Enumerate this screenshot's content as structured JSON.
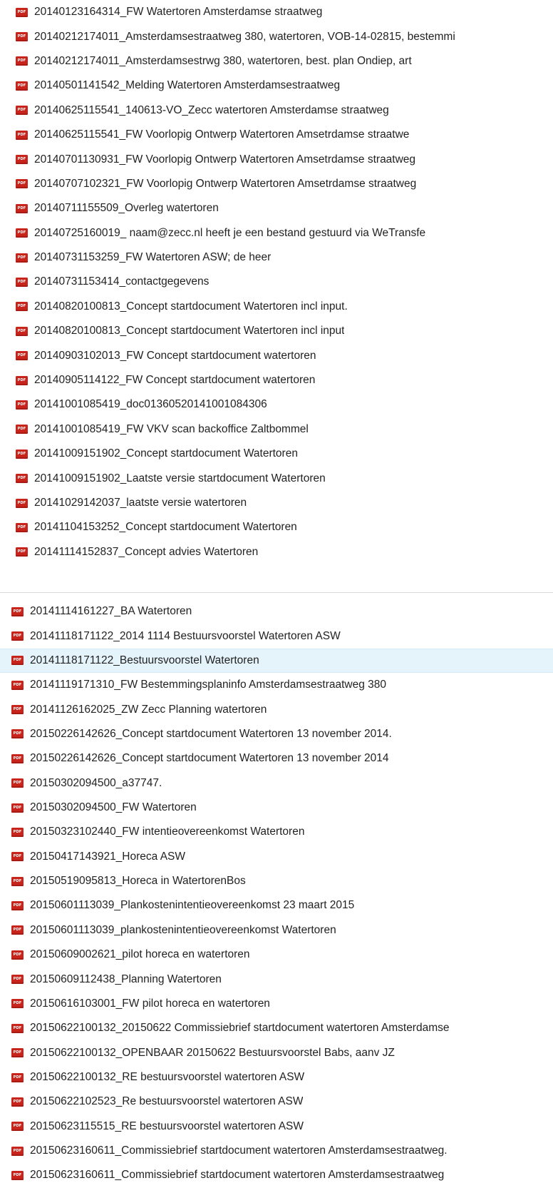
{
  "files_top": [
    "20140123164314_FW Watertoren Amsterdamse straatweg",
    "20140212174011_Amsterdamsestraatweg 380, watertoren, VOB-14-02815, bestemmi",
    "20140212174011_Amsterdamsestrwg 380, watertoren, best. plan Ondiep, art",
    "20140501141542_Melding Watertoren Amsterdamsestraatweg",
    "20140625115541_140613-VO_Zecc watertoren Amsterdamse straatweg",
    "20140625115541_FW Voorlopig Ontwerp Watertoren Amsetrdamse straatwe",
    "20140701130931_FW Voorlopig Ontwerp Watertoren Amsetrdamse straatweg",
    "20140707102321_FW Voorlopig Ontwerp Watertoren Amsetrdamse straatweg",
    "20140711155509_Overleg watertoren",
    "20140725160019_ naam@zecc.nl heeft je een bestand gestuurd via WeTransfe",
    "20140731153259_FW Watertoren ASW; de heer",
    "20140731153414_contactgegevens",
    "20140820100813_Concept startdocument Watertoren incl input.",
    "20140820100813_Concept startdocument Watertoren incl input",
    "20140903102013_FW Concept startdocument watertoren",
    "20140905114122_FW  Concept startdocument watertoren",
    "20141001085419_doc01360520141001084306",
    "20141001085419_FW VKV scan backoffice Zaltbommel",
    "20141009151902_Concept startdocument Watertoren",
    "20141009151902_Laatste versie startdocument Watertoren",
    "20141029142037_laatste versie watertoren",
    "20141104153252_Concept startdocument Watertoren",
    "20141114152837_Concept advies Watertoren"
  ],
  "files_bottom": [
    "20141114161227_BA Watertoren",
    "20141118171122_2014 1114 Bestuursvoorstel Watertoren ASW",
    "20141118171122_Bestuursvoorstel Watertoren",
    "20141119171310_FW Bestemmingsplaninfo Amsterdamsestraatweg 380",
    "20141126162025_ZW Zecc Planning watertoren",
    "20150226142626_Concept startdocument Watertoren 13 november 2014.",
    "20150226142626_Concept startdocument Watertoren 13 november 2014",
    "20150302094500_a37747.",
    "20150302094500_FW Watertoren",
    "20150323102440_FW intentieovereenkomst Watertoren",
    "20150417143921_Horeca ASW",
    "20150519095813_Horeca in WatertorenBos",
    "20150601113039_Plankostenintentieovereenkomst 23 maart 2015",
    "20150601113039_plankostenintentieovereenkomst Watertoren",
    "20150609002621_pilot horeca en watertoren",
    "20150609112438_Planning Watertoren",
    "20150616103001_FW pilot horeca en watertoren",
    "20150622100132_20150622 Commissiebrief startdocument watertoren Amsterdamse",
    "20150622100132_OPENBAAR 20150622 Bestuursvoorstel Babs, aanv JZ",
    "20150622100132_RE bestuursvoorstel watertoren ASW",
    "20150622102523_Re bestuursvoorstel watertoren ASW",
    "20150623115515_RE bestuursvoorstel watertoren ASW",
    "20150623160611_Commissiebrief startdocument watertoren Amsterdamsestraatweg.",
    "20150623160611_Commissiebrief startdocument watertoren Amsterdamsestraatweg"
  ],
  "selected_bottom_index": 2,
  "icon": "pdf-file-icon",
  "colors": {
    "selection": "#e5f3fb",
    "pdf_icon": "#c9241c",
    "text": "#222222"
  }
}
